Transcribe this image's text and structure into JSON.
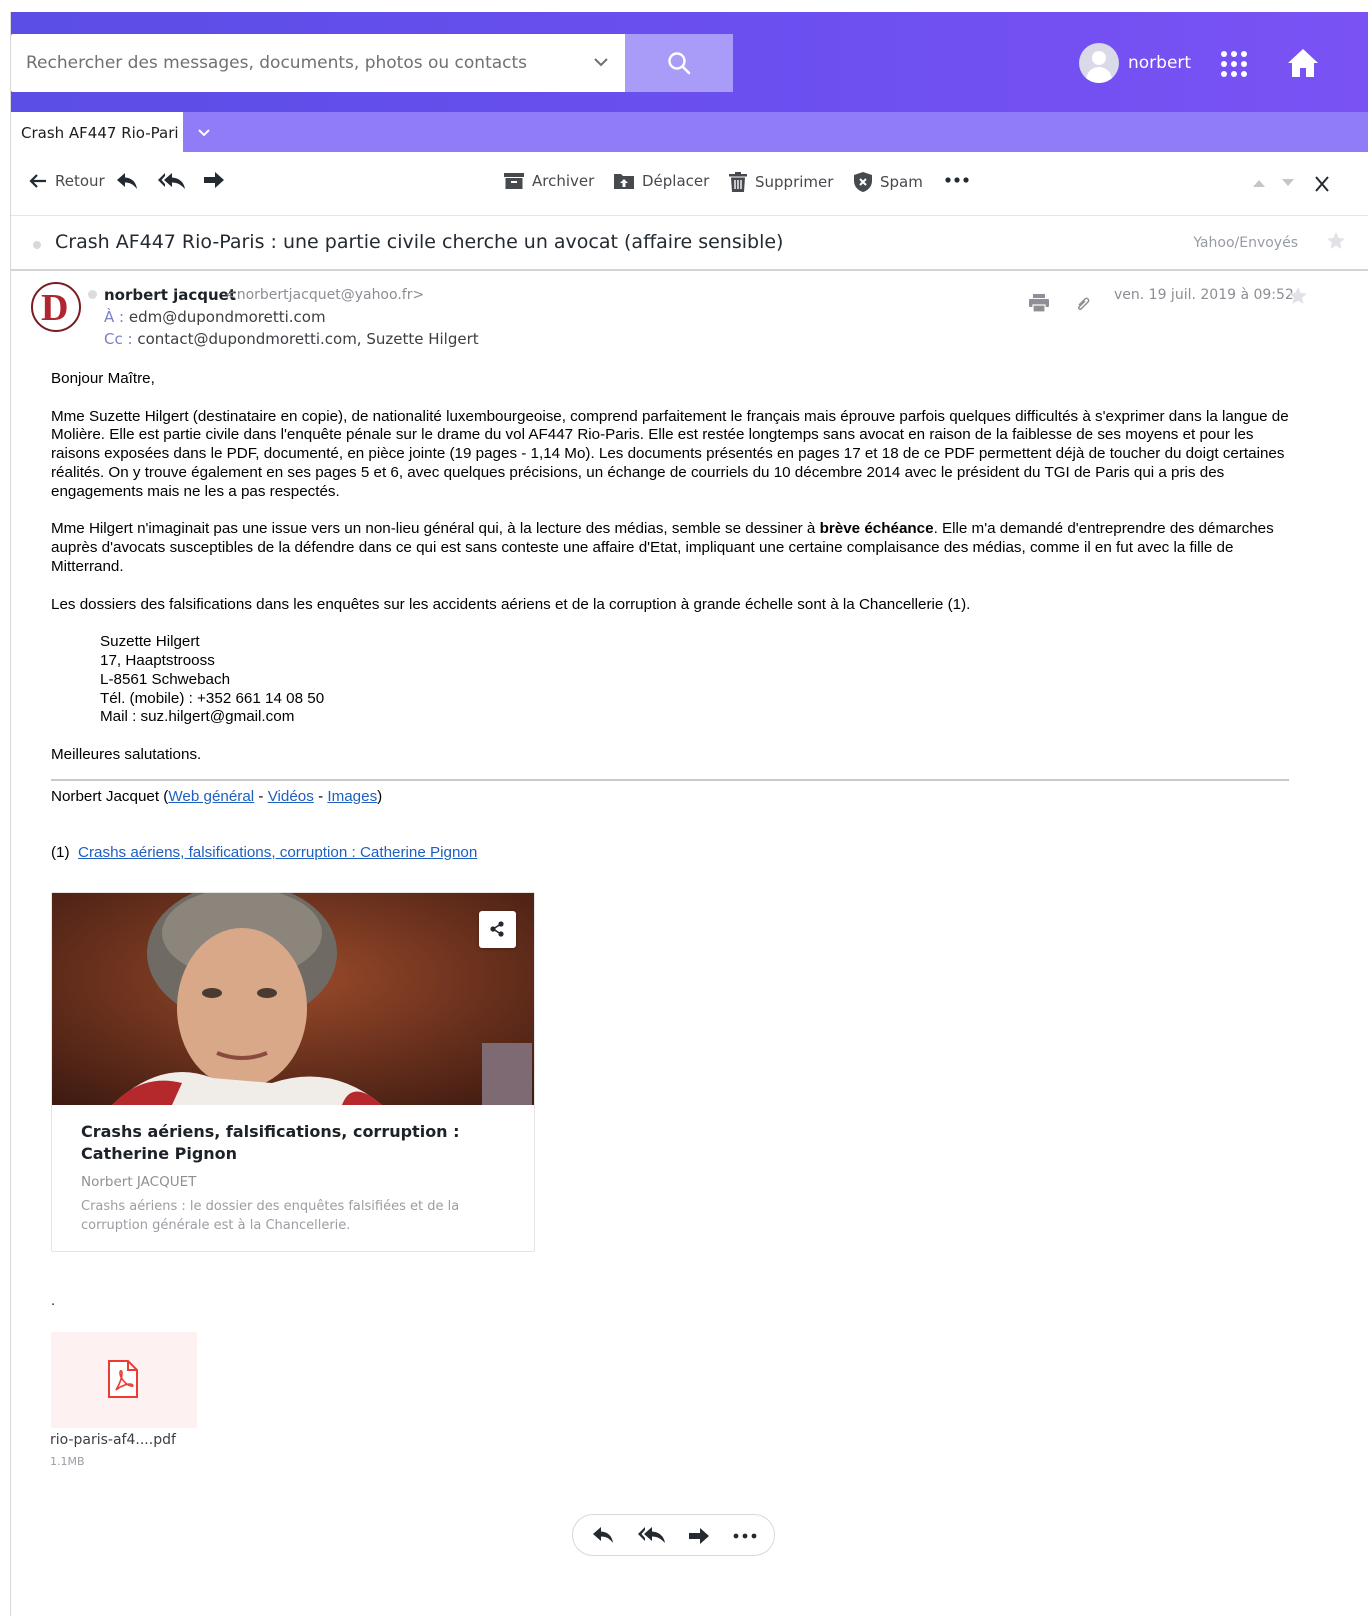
{
  "search": {
    "placeholder": "Rechercher des messages, documents, photos ou contacts"
  },
  "user": {
    "name": "norbert"
  },
  "tab": {
    "label": "Crash AF447 Rio-Pari"
  },
  "toolbar": {
    "back": "Retour",
    "archive": "Archiver",
    "move": "Déplacer",
    "delete": "Supprimer",
    "spam": "Spam"
  },
  "message": {
    "subject": "Crash AF447 Rio-Paris : une partie civile cherche un avocat (affaire sensible)",
    "folder": "Yahoo/Envoyés",
    "sender_name": "norbert jacquet",
    "sender_email": "<norbertjacquet@yahoo.fr>",
    "to_label": "À :",
    "to": "edm@dupondmoretti.com",
    "cc_label": "Cc :",
    "cc": "contact@dupondmoretti.com,  Suzette Hilgert",
    "date": "ven. 19 juil. 2019 à 09:52",
    "avatar_letter": "D"
  },
  "body": {
    "greeting": "Bonjour Maître,",
    "p1": "Mme Suzette Hilgert (destinataire en copie), de nationalité luxembourgeoise, comprend parfaitement le français mais éprouve parfois quelques difficultés à s'exprimer dans la langue de Molière. Elle est partie civile dans l'enquête pénale sur le drame du vol AF447 Rio-Paris. Elle est restée longtemps sans avocat en raison de la faiblesse de ses moyens et pour les raisons exposées dans le PDF, documenté, en pièce jointe (19 pages - 1,14 Mo). Les documents présentés en pages 17 et 18 de ce PDF permettent déjà de toucher du doigt certaines réalités. On y trouve également en ses pages 5 et 6, avec quelques précisions, un échange de courriels du 10 décembre 2014 avec le président du TGI de Paris qui a pris des engagements mais ne les a pas respectés.",
    "p2_before": "Mme Hilgert n'imaginait pas une issue vers un non-lieu général qui, à la lecture des médias, semble se dessiner à ",
    "p2_bold": "brève échéance",
    "p2_after": ". Elle m'a demandé d'entreprendre des démarches auprès d'avocats susceptibles de la défendre dans ce qui est sans conteste une affaire d'Etat, impliquant une certaine complaisance des médias, comme il en fut avec la fille de Mitterrand.",
    "p3": "Les dossiers des falsifications dans les enquêtes sur les accidents aériens et de la corruption à grande échelle sont à la Chancellerie (1).",
    "address": [
      "Suzette Hilgert",
      "17, Haaptstrooss",
      "L-8561 Schwebach",
      "Tél. (mobile) : +352 661 14 08 50",
      "Mail : suz.hilgert@gmail.com"
    ],
    "closing": "Meilleures salutations.",
    "sig_name": "Norbert Jacquet (",
    "sig_link1": "Web général",
    "sig_sep1": " - ",
    "sig_link2": "Vidéos",
    "sig_sep2": " - ",
    "sig_link3": "Images",
    "sig_end": ")",
    "footnote_num": "(1)  ",
    "footnote_link": "Crashs aériens, falsifications, corruption : Catherine Pignon",
    "dot": "."
  },
  "card": {
    "title": "Crashs aériens, falsifications, corruption : Catherine Pignon",
    "author": "Norbert JACQUET",
    "description": "Crashs aériens : le dossier des enquêtes falsifiées et de la corruption générale est à la Chancellerie."
  },
  "attachment": {
    "name": "rio-paris-af4....pdf",
    "size": "1.1MB",
    "icon": "pdf-icon"
  },
  "colors": {
    "header_start": "#5a4ee6",
    "header_end": "#7a52f4",
    "tabbar": "#8f7cf6",
    "search_button": "#a99cf8",
    "link": "#1f5fbf"
  }
}
